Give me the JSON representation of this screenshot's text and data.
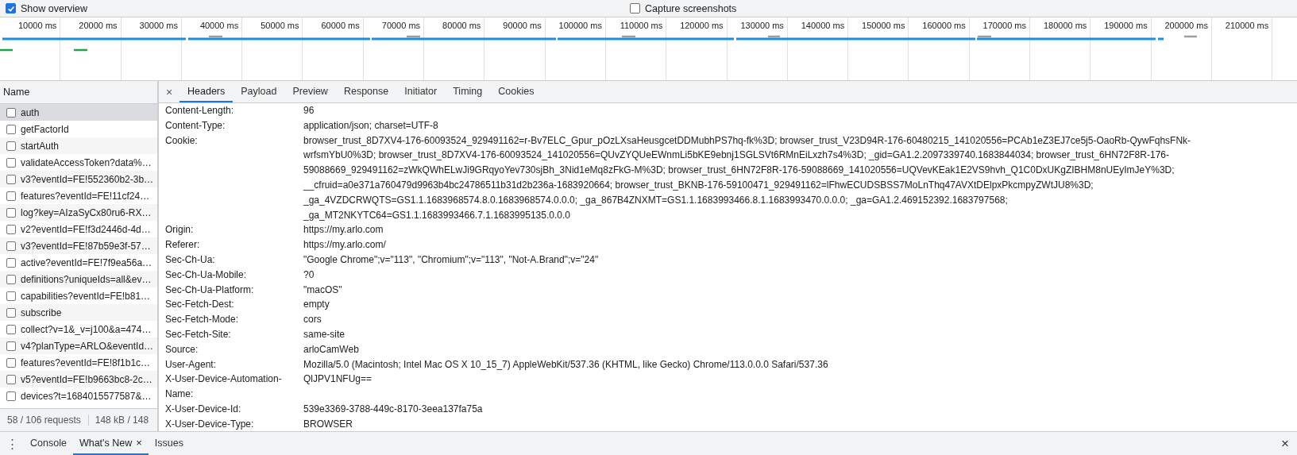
{
  "toolbar": {
    "options": [
      {
        "label": "Show overview",
        "checked": true
      },
      {
        "label": "Capture screenshots",
        "checked": false
      }
    ]
  },
  "overview": {
    "ticks": [
      "10000 ms",
      "20000 ms",
      "30000 ms",
      "40000 ms",
      "50000 ms",
      "60000 ms",
      "70000 ms",
      "80000 ms",
      "90000 ms",
      "100000 ms",
      "110000 ms",
      "120000 ms",
      "130000 ms",
      "140000 ms",
      "150000 ms",
      "160000 ms",
      "170000 ms",
      "180000 ms",
      "190000 ms",
      "200000 ms",
      "210000 ms"
    ]
  },
  "requests": {
    "column": "Name",
    "rows": [
      {
        "name": "auth",
        "selected": true,
        "checked": false
      },
      {
        "name": "getFactorId",
        "selected": false,
        "checked": false
      },
      {
        "name": "startAuth",
        "selected": false,
        "checked": false
      },
      {
        "name": "validateAccessToken?data%…",
        "selected": false,
        "checked": false
      },
      {
        "name": "v3?eventId=FE!552360b2-3b…",
        "selected": false,
        "checked": false
      },
      {
        "name": "features?eventId=FE!11cf24…",
        "selected": false,
        "checked": false
      },
      {
        "name": "log?key=AIzaSyCx80ru6-RX…",
        "selected": false,
        "checked": false
      },
      {
        "name": "v2?eventId=FE!f3d2446d-4d…",
        "selected": false,
        "checked": false
      },
      {
        "name": "v3?eventId=FE!87b59e3f-57…",
        "selected": false,
        "checked": false
      },
      {
        "name": "active?eventId=FE!7f9ea56a…",
        "selected": false,
        "checked": false
      },
      {
        "name": "definitions?uniqueIds=all&ev…",
        "selected": false,
        "checked": false
      },
      {
        "name": "capabilities?eventId=FE!b81…",
        "selected": false,
        "checked": false
      },
      {
        "name": "subscribe",
        "selected": false,
        "checked": false
      },
      {
        "name": "collect?v=1&_v=j100&a=474…",
        "selected": false,
        "checked": false
      },
      {
        "name": "v4?planType=ARLO&eventId…",
        "selected": false,
        "checked": false
      },
      {
        "name": "features?eventId=FE!8f1b1c…",
        "selected": false,
        "checked": false
      },
      {
        "name": "v5?eventId=FE!b9663bc8-2c…",
        "selected": false,
        "checked": false
      },
      {
        "name": "devices?t=1684015577587&…",
        "selected": false,
        "checked": false
      }
    ],
    "summary": {
      "requests": "58 / 106 requests",
      "transferred": "148 kB / 148"
    }
  },
  "details": {
    "close": "×",
    "tabs": [
      {
        "label": "Headers",
        "selected": true
      },
      {
        "label": "Payload",
        "selected": false
      },
      {
        "label": "Preview",
        "selected": false
      },
      {
        "label": "Response",
        "selected": false
      },
      {
        "label": "Initiator",
        "selected": false
      },
      {
        "label": "Timing",
        "selected": false
      },
      {
        "label": "Cookies",
        "selected": false
      }
    ],
    "headers": [
      {
        "name": "Content-Length:",
        "value": "96"
      },
      {
        "name": "Content-Type:",
        "value": "application/json; charset=UTF-8"
      },
      {
        "name": "Cookie:",
        "value": "browser_trust_8D7XV4-176-60093524_929491162=r-Bv7ELC_Gpur_pOzLXsaHeusgcetDDMubhPS7hq-fk%3D; browser_trust_V23D94R-176-60480215_141020556=PCAb1eZ3EJ7ce5j5-OaoRb-QywFqhsFNk-wrfsmYbU0%3D; browser_trust_8D7XV4-176-60093524_141020556=QUvZYQUeEWnmLi5bKE9ebnj1SGLSVt6RMnEiLxzh7s4%3D; _gid=GA1.2.2097339740.1683844034; browser_trust_6HN72F8R-176-59088669_929491162=zWkQWhELwJi9GRqyoYev730sjBh_3Nid1eMq8zFkG-M%3D; browser_trust_6HN72F8R-176-59088669_141020556=UQVevKEak1E2VS9hvh_Q1C0DxUKgZIBHM8nUEyImJeY%3D; __cfruid=a0e371a760479d9963b4bc24786511b31d2b236a-1683920664; browser_trust_BKNB-176-59100471_929491162=lFhwECUDSBSS7MoLnThq47AVXtDElpxPkcmpyZWtJU8%3D; _ga_4VZDCRWQTS=GS1.1.1683968574.8.0.1683968574.0.0.0; _ga_867B4ZNXMT=GS1.1.1683993466.8.1.1683993470.0.0.0; _ga=GA1.2.469152392.1683797568; _ga_MT2NKYTC64=GS1.1.1683993466.7.1.1683995135.0.0.0"
      },
      {
        "name": "Origin:",
        "value": "https://my.arlo.com"
      },
      {
        "name": "Referer:",
        "value": "https://my.arlo.com/"
      },
      {
        "name": "Sec-Ch-Ua:",
        "value": "\"Google Chrome\";v=\"113\", \"Chromium\";v=\"113\", \"Not-A.Brand\";v=\"24\""
      },
      {
        "name": "Sec-Ch-Ua-Mobile:",
        "value": "?0"
      },
      {
        "name": "Sec-Ch-Ua-Platform:",
        "value": "\"macOS\""
      },
      {
        "name": "Sec-Fetch-Dest:",
        "value": "empty"
      },
      {
        "name": "Sec-Fetch-Mode:",
        "value": "cors"
      },
      {
        "name": "Sec-Fetch-Site:",
        "value": "same-site"
      },
      {
        "name": "Source:",
        "value": "arloCamWeb"
      },
      {
        "name": "User-Agent:",
        "value": "Mozilla/5.0 (Macintosh; Intel Mac OS X 10_15_7) AppleWebKit/537.36 (KHTML, like Gecko) Chrome/113.0.0.0 Safari/537.36"
      },
      {
        "name": "X-User-Device-Automation-Name:",
        "value": "QlJPV1NFUg=="
      },
      {
        "name": "X-User-Device-Id:",
        "value": "539e3369-3788-449c-8170-3eea137fa75a"
      },
      {
        "name": "X-User-Device-Type:",
        "value": "BROWSER"
      }
    ]
  },
  "drawer": {
    "menu": "⋮",
    "tabs": [
      {
        "label": "Console",
        "selected": false
      },
      {
        "label": "What's New",
        "selected": true,
        "close": "×"
      },
      {
        "label": "Issues",
        "selected": false
      }
    ],
    "close": "×"
  }
}
